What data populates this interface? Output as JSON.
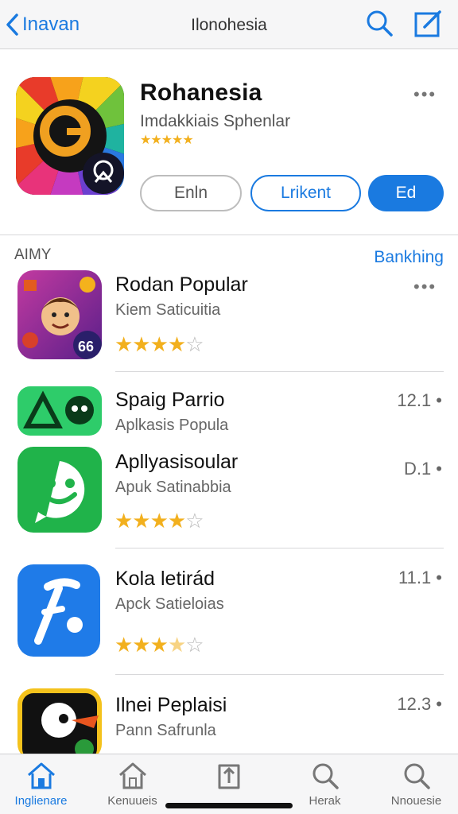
{
  "nav": {
    "back_label": "Inavan",
    "title": "Ilonohesia"
  },
  "featured": {
    "title": "Rohanesia",
    "subtitle": "Imdakkiais Sphenlar",
    "stars": "★★★★★",
    "rating": 4.5,
    "buttons": [
      "Enln",
      "Lrikent",
      "Ed"
    ]
  },
  "section": {
    "title": "AIMY",
    "link": "Bankhing"
  },
  "apps": [
    {
      "title": "Rodan Popular",
      "subtitle": "Kiem Saticuitia",
      "stars": 4,
      "value": ""
    },
    {
      "title": "Spaig Parrio",
      "subtitle": "Aplkasis Popula",
      "stars": null,
      "value": "12.1 •"
    },
    {
      "title": "Apllyasisoular",
      "subtitle": "Apuk Satinabbia",
      "stars": 4,
      "value": "D.1 •"
    },
    {
      "title": "Kola letirád",
      "subtitle": "Apck Satieloias",
      "stars": 3.5,
      "value": "11.1 •"
    },
    {
      "title": "Ilnei Peplaisi",
      "subtitle": "Pann Safrunla",
      "stars": null,
      "value": "12.3 •"
    }
  ],
  "tabs": [
    {
      "label": "Inglienare",
      "icon": "home-icon",
      "active": true
    },
    {
      "label": "Kenuueis",
      "icon": "home-outline-icon",
      "active": false
    },
    {
      "label": "",
      "icon": "updates-icon",
      "active": false
    },
    {
      "label": "Herak",
      "icon": "search-icon",
      "active": false
    },
    {
      "label": "Nnouesie",
      "icon": "search-icon",
      "active": false
    }
  ],
  "colors": {
    "accent": "#1a7ae0",
    "star": "#f2b01e",
    "background": "#ffffff"
  }
}
